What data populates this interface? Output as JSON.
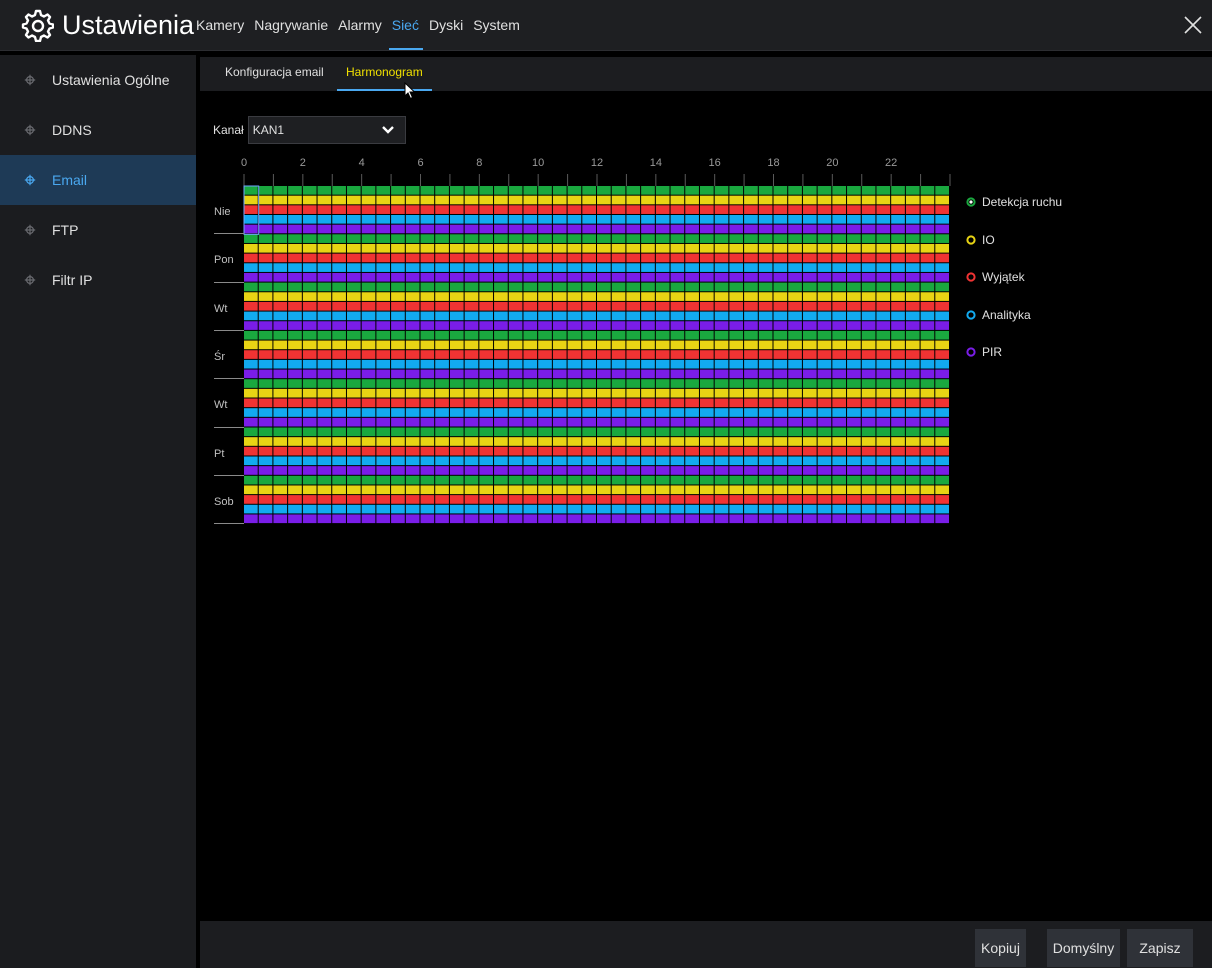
{
  "header": {
    "title": "Ustawienia",
    "nav": [
      {
        "label": "Kamery",
        "active": false
      },
      {
        "label": "Nagrywanie",
        "active": false
      },
      {
        "label": "Alarmy",
        "active": false
      },
      {
        "label": "Sieć",
        "active": true
      },
      {
        "label": "Dyski",
        "active": false
      },
      {
        "label": "System",
        "active": false
      }
    ]
  },
  "sidebar": {
    "items": [
      {
        "label": "Ustawienia Ogólne",
        "active": false
      },
      {
        "label": "DDNS",
        "active": false
      },
      {
        "label": "Email",
        "active": true
      },
      {
        "label": "FTP",
        "active": false
      },
      {
        "label": "Filtr IP",
        "active": false
      }
    ]
  },
  "subtabs": [
    {
      "label": "Konfiguracja email",
      "active": false
    },
    {
      "label": "Harmonogram",
      "active": true
    }
  ],
  "channel": {
    "label": "Kanał",
    "value": "KAN1"
  },
  "schedule": {
    "hour_labels": [
      "0",
      "2",
      "4",
      "6",
      "8",
      "10",
      "12",
      "14",
      "16",
      "18",
      "20",
      "22"
    ],
    "days": [
      "Nie",
      "Pon",
      "Wt",
      "Śr",
      "Wt",
      "Pt",
      "Sob"
    ],
    "layers": [
      {
        "label": "Detekcja ruchu",
        "color": "#1aa83f"
      },
      {
        "label": "IO",
        "color": "#e8d414"
      },
      {
        "label": "Wyjątek",
        "color": "#f03333"
      },
      {
        "label": "Analityka",
        "color": "#12aaf0"
      },
      {
        "label": "PIR",
        "color": "#7a1de8"
      }
    ],
    "slots_per_day": 48,
    "all_enabled": true
  },
  "buttons": {
    "copy": "Kopiuj",
    "default": "Domyślny",
    "save": "Zapisz"
  },
  "colors": {
    "accent": "#4aa8f0",
    "active_subtab": "#f0e000"
  }
}
